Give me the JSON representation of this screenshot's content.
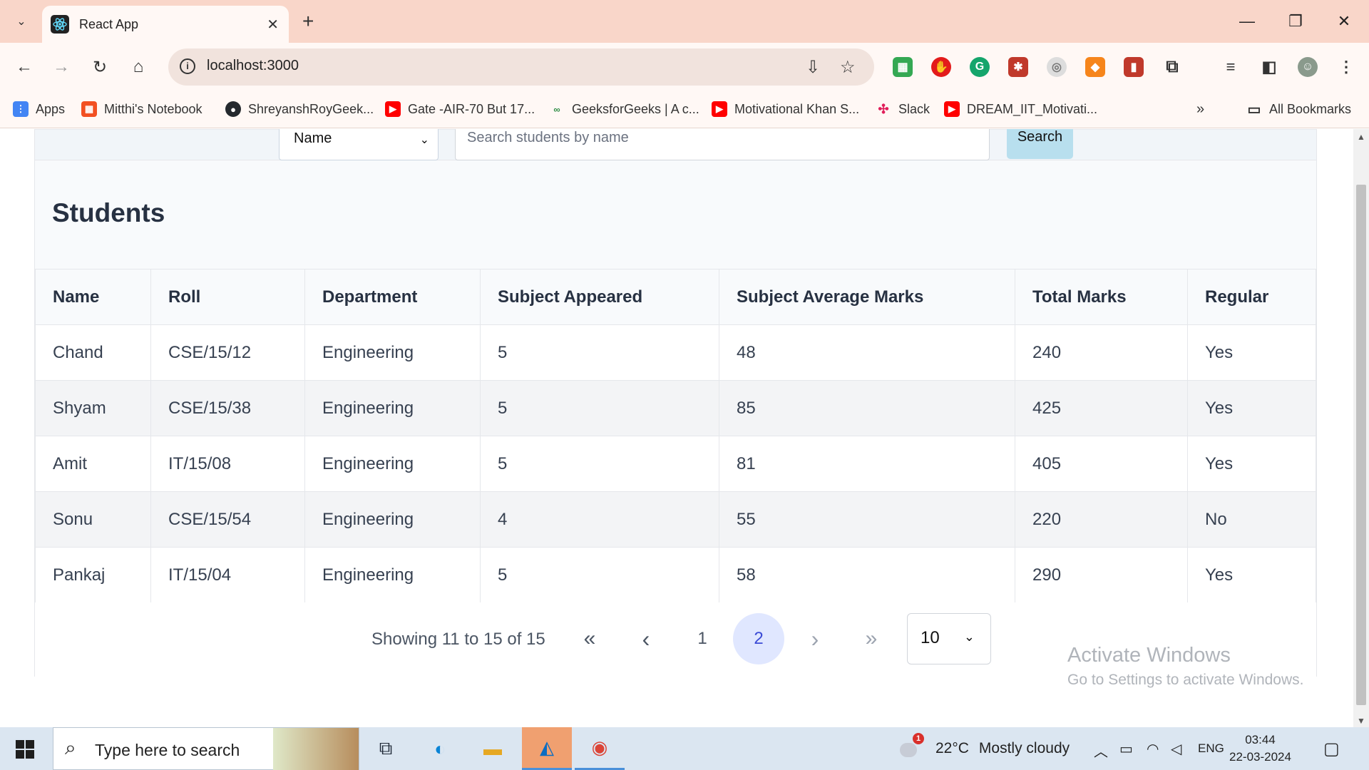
{
  "browser": {
    "tab_title": "React App",
    "url": "localhost:3000",
    "bookmarks": [
      {
        "label": "Apps",
        "icon": "apps-grid-icon",
        "color": "#4285f4"
      },
      {
        "label": "Mitthi's Notebook",
        "icon": "microsoft-icon",
        "color": "#f25022"
      },
      {
        "label": "ShreyanshRoyGeek...",
        "icon": "github-icon",
        "color": "#24292e"
      },
      {
        "label": "Gate -AIR-70 But 17...",
        "icon": "youtube-icon",
        "color": "#ff0000"
      },
      {
        "label": "GeeksforGeeks | A c...",
        "icon": "gfg-icon",
        "color": "#2f8d46"
      },
      {
        "label": "Motivational Khan S...",
        "icon": "youtube-icon",
        "color": "#ff0000"
      },
      {
        "label": "Slack",
        "icon": "slack-icon",
        "color": "#4a154b"
      },
      {
        "label": "DREAM_IIT_Motivati...",
        "icon": "youtube-icon",
        "color": "#ff0000"
      }
    ],
    "all_bookmarks": "All Bookmarks"
  },
  "search": {
    "field_select": "Name",
    "placeholder": "Search students by name",
    "button": "Search"
  },
  "students": {
    "title": "Students",
    "columns": [
      "Name",
      "Roll",
      "Department",
      "Subject Appeared",
      "Subject Average Marks",
      "Total Marks",
      "Regular"
    ],
    "rows": [
      [
        "Chand",
        "CSE/15/12",
        "Engineering",
        "5",
        "48",
        "240",
        "Yes"
      ],
      [
        "Shyam",
        "CSE/15/38",
        "Engineering",
        "5",
        "85",
        "425",
        "Yes"
      ],
      [
        "Amit",
        "IT/15/08",
        "Engineering",
        "5",
        "81",
        "405",
        "Yes"
      ],
      [
        "Sonu",
        "CSE/15/54",
        "Engineering",
        "4",
        "55",
        "220",
        "No"
      ],
      [
        "Pankaj",
        "IT/15/04",
        "Engineering",
        "5",
        "58",
        "290",
        "Yes"
      ]
    ]
  },
  "pagination": {
    "showing": "Showing 11 to 15 of 15",
    "first": "«",
    "prev": "‹",
    "pages": [
      "1",
      "2"
    ],
    "active_page": "2",
    "next": "›",
    "last": "»",
    "page_size": "10"
  },
  "watermark": {
    "line1": "Activate Windows",
    "line2": "Go to Settings to activate Windows."
  },
  "taskbar": {
    "search_placeholder": "Type here to search",
    "weather_temp": "22°C",
    "weather_desc": "Mostly cloudy",
    "weather_badge": "1",
    "language": "ENG",
    "time": "03:44",
    "date": "22-03-2024"
  }
}
